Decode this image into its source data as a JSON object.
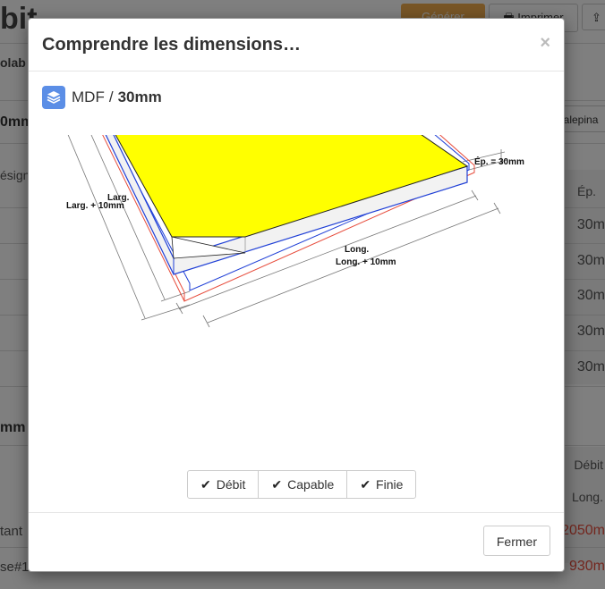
{
  "background": {
    "title": "bit",
    "orange_button": "Générer",
    "print_button": "Imprimer",
    "subtitle": "olab",
    "section1_heading": "0mm",
    "calepinage_button": "Calepina",
    "designation_label": "ésigna",
    "ep_header": "Ép.",
    "ep_values": [
      "30m",
      "30m",
      "30m",
      "30m",
      "30m"
    ],
    "section2_heading": "mm",
    "debit_label": "Débit",
    "long_label": "Long.",
    "row_a_label": "tant",
    "row_a_value": "2050m",
    "row_b_label": "se#1",
    "row_b_value": "930m"
  },
  "modal": {
    "title": "Comprendre les dimensions…",
    "close_symbol": "×",
    "material": {
      "name": "MDF",
      "separator": "/",
      "thickness": "30mm",
      "icon": "layers-icon"
    },
    "diagram_labels": {
      "thickness": "Ép. = 30mm",
      "width": "Larg.",
      "width_plus": "Larg. + 10mm",
      "length": "Long.",
      "length_plus": "Long. + 10mm"
    },
    "toggles": [
      {
        "label": "Débit",
        "icon": "check-icon"
      },
      {
        "label": "Capable",
        "icon": "check-icon"
      },
      {
        "label": "Finie",
        "icon": "check-icon"
      }
    ],
    "footer_button": "Fermer"
  },
  "colors": {
    "panel_top": "#ffff00",
    "outline_debit": "#e74c3c",
    "outline_capable": "#1f3fd6",
    "accent_icon": "#5b8ee6"
  }
}
